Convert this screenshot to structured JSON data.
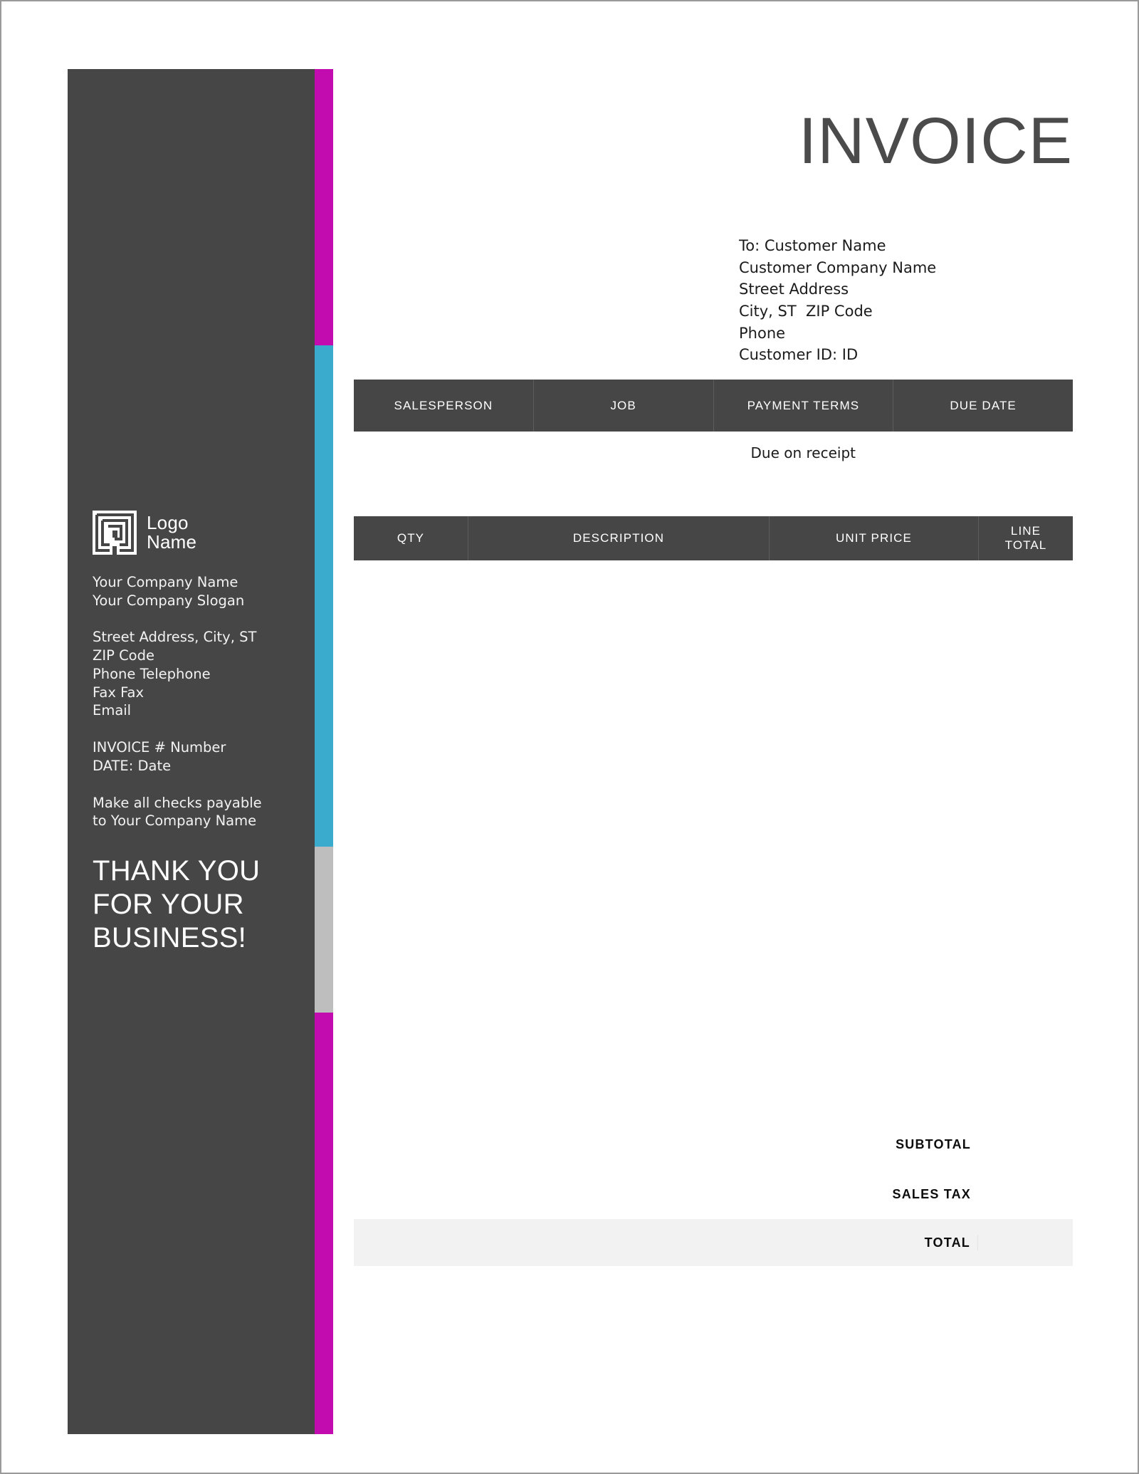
{
  "document": {
    "title": "INVOICE"
  },
  "sidebar": {
    "logo": {
      "icon": "labyrinth-logo-icon",
      "line1": "Logo",
      "line2": "Name"
    },
    "company": {
      "name": "Your Company Name",
      "slogan": "Your Company Slogan"
    },
    "contact": {
      "address": "Street Address, City, ST\nZIP Code",
      "phone": "Phone Telephone",
      "fax": "Fax Fax",
      "email": "Email"
    },
    "invoice_meta": {
      "number": "INVOICE # Number",
      "date": "DATE: Date"
    },
    "payable_note": "Make all checks payable\nto Your Company Name",
    "thanks": {
      "line1": "THANK YOU",
      "line2": "FOR YOUR",
      "line3": "BUSINESS!"
    }
  },
  "bill_to": {
    "to": "To: Customer Name",
    "company": "Customer Company Name",
    "street": "Street Address",
    "city_state_zip": "City, ST  ZIP Code",
    "phone": "Phone",
    "customer_id": "Customer ID: ID"
  },
  "meta_table": {
    "headers": [
      "SALESPERSON",
      "JOB",
      "PAYMENT TERMS",
      "DUE DATE"
    ],
    "values": [
      "",
      "",
      "Due on receipt",
      ""
    ]
  },
  "items_table": {
    "headers": {
      "qty": "QTY",
      "description": "DESCRIPTION",
      "unit_price": "UNIT PRICE",
      "line_total_1": "LINE",
      "line_total_2": "TOTAL"
    },
    "rows": []
  },
  "totals": {
    "subtotal_label": "SUBTOTAL",
    "subtotal_value": "",
    "sales_tax_label": "SALES TAX",
    "sales_tax_value": "",
    "total_label": "TOTAL",
    "total_value": ""
  },
  "colors": {
    "panel": "#464646",
    "magenta": "#c20cb0",
    "cyan": "#3aabcd",
    "gray": "#bebebe",
    "total_band": "#f2f2f2",
    "page_border": "#9a9a9a"
  }
}
